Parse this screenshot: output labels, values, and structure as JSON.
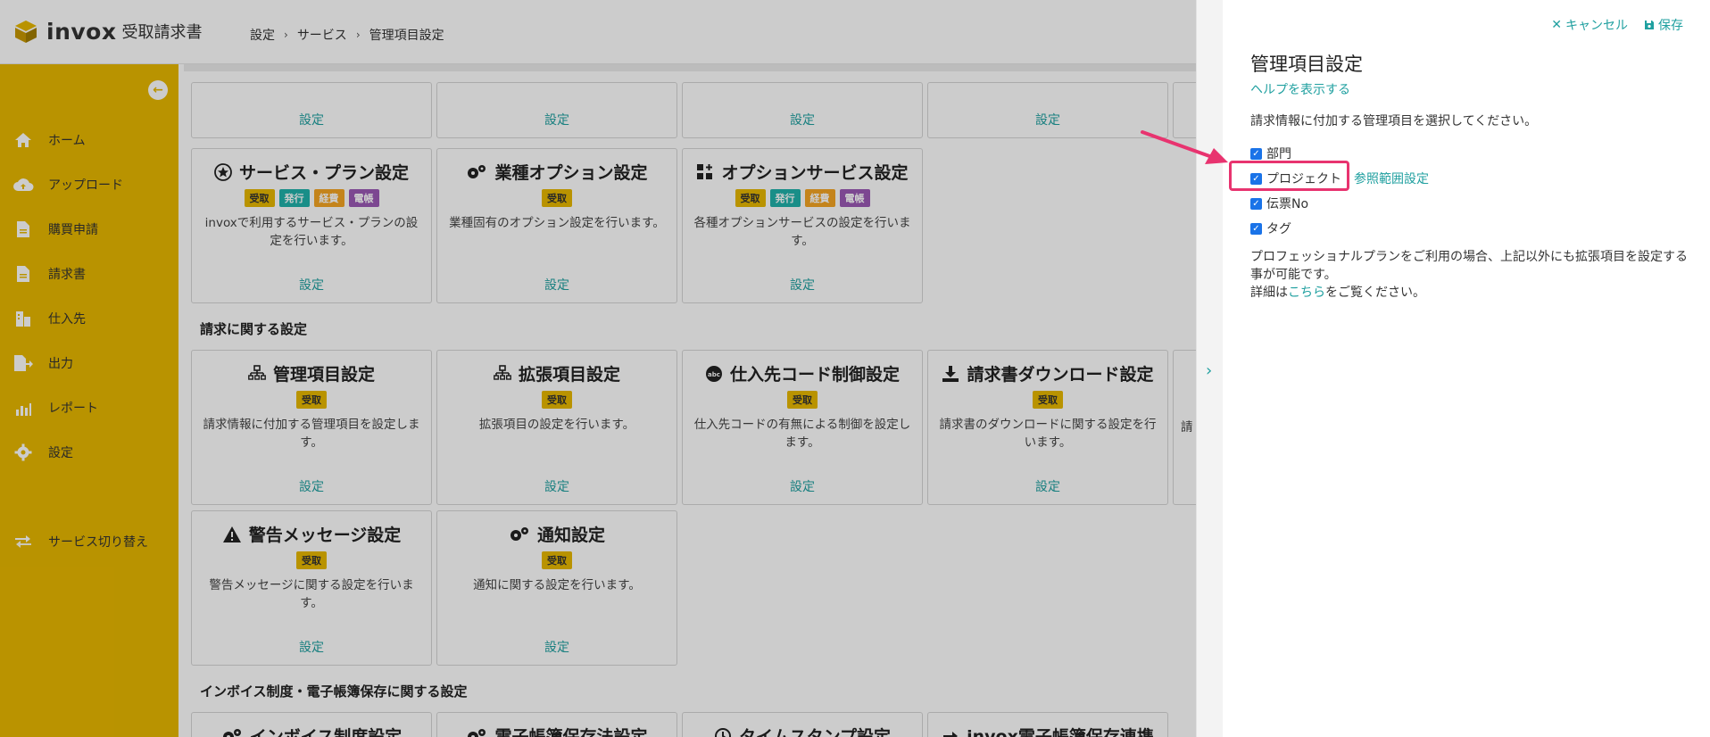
{
  "app": {
    "logo_text": "invox",
    "logo_sub": "受取請求書"
  },
  "breadcrumb": [
    "設定",
    "サービス",
    "管理項目設定"
  ],
  "sidebar": {
    "items": [
      {
        "label": "ホーム",
        "icon": "home-icon"
      },
      {
        "label": "アップロード",
        "icon": "cloud-upload-icon"
      },
      {
        "label": "購買申請",
        "icon": "document-icon"
      },
      {
        "label": "請求書",
        "icon": "invoice-icon"
      },
      {
        "label": "仕入先",
        "icon": "building-icon"
      },
      {
        "label": "出力",
        "icon": "export-icon"
      },
      {
        "label": "レポート",
        "icon": "chart-icon"
      },
      {
        "label": "設定",
        "icon": "gear-icon"
      }
    ],
    "switch_label": "サービス切り替え"
  },
  "top_cards": [
    {
      "set_label": "設定"
    },
    {
      "set_label": "設定"
    },
    {
      "set_label": "設定"
    },
    {
      "set_label": "設定"
    }
  ],
  "row1": [
    {
      "title": "サービス・プラン設定",
      "tags": [
        "受取",
        "発行",
        "経費",
        "電帳"
      ],
      "desc": "invoxで利用するサービス・プランの設定を行います。",
      "set_label": "設定"
    },
    {
      "title": "業種オプション設定",
      "tags": [
        "受取"
      ],
      "desc": "業種固有のオプション設定を行います。",
      "set_label": "設定"
    },
    {
      "title": "オプションサービス設定",
      "tags": [
        "受取",
        "発行",
        "経費",
        "電帳"
      ],
      "desc": "各種オプションサービスの設定を行います。",
      "set_label": "設定"
    }
  ],
  "section_billing": "請求に関する設定",
  "row2": [
    {
      "title": "管理項目設定",
      "tags": [
        "受取"
      ],
      "desc": "請求情報に付加する管理項目を設定します。",
      "set_label": "設定"
    },
    {
      "title": "拡張項目設定",
      "tags": [
        "受取"
      ],
      "desc": "拡張項目の設定を行います。",
      "set_label": "設定"
    },
    {
      "title": "仕入先コード制御設定",
      "tags": [
        "受取"
      ],
      "desc": "仕入先コードの有無による制御を設定します。",
      "set_label": "設定"
    },
    {
      "title": "請求書ダウンロード設定",
      "tags": [
        "受取"
      ],
      "desc": "請求書のダウンロードに関する設定を行います。",
      "set_label": "設定"
    }
  ],
  "row2_partial_desc": "請",
  "row3": [
    {
      "title": "警告メッセージ設定",
      "tags": [
        "受取"
      ],
      "desc": "警告メッセージに関する設定を行います。",
      "set_label": "設定"
    },
    {
      "title": "通知設定",
      "tags": [
        "受取"
      ],
      "desc": "通知に関する設定を行います。",
      "set_label": "設定"
    }
  ],
  "section_invoice": "インボイス制度・電子帳簿保存に関する設定",
  "row4_titles": [
    "インボイス制度設定",
    "電子帳簿保存法設定",
    "タイムスタンプ設定",
    "invox電子帳簿保存連携"
  ],
  "drawer": {
    "cancel_label": "キャンセル",
    "save_label": "保存",
    "title": "管理項目設定",
    "help_link": "ヘルプを表示する",
    "instruction": "請求情報に付加する管理項目を選択してください。",
    "checkboxes": [
      {
        "label": "部門",
        "checked": true
      },
      {
        "label": "プロジェクト",
        "checked": true
      },
      {
        "label": "伝票No",
        "checked": true
      },
      {
        "label": "タグ",
        "checked": true
      }
    ],
    "ref_link": "参照範囲設定",
    "note_line1": "プロフェッショナルプランをご利用の場合、上記以外にも拡張項目を設定する事が可能です。",
    "note_prefix": "詳細は",
    "note_link": "こちら",
    "note_suffix": "をご覧ください。"
  },
  "colors": {
    "sidebar": "#e8b800",
    "accent": "#20a0a0",
    "highlight": "#e8336f",
    "checkbox": "#1a73e8"
  }
}
